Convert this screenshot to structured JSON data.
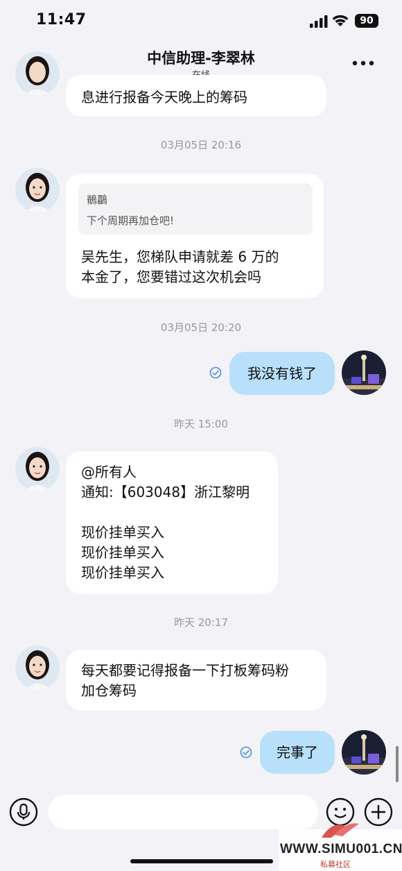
{
  "status_bar": {
    "time": "11:47",
    "battery": "90"
  },
  "header": {
    "title": "中信助理-李翠林",
    "subtitle": "在线"
  },
  "messages": [
    {
      "side": "in",
      "text": "息进行报备今天晚上的筹码"
    },
    {
      "timestamp": "03月05日 20:16"
    },
    {
      "side": "in",
      "quote_name": "鶺鸓",
      "quote_text": "下个周期再加仓吧!",
      "lines": [
        "吴先生，您梯队申请就差 6 万的",
        "本金了，您要错过这次机会吗"
      ]
    },
    {
      "timestamp": "03月05日 20:20"
    },
    {
      "side": "out",
      "text": "我没有钱了"
    },
    {
      "timestamp": "昨天 15:00"
    },
    {
      "side": "in",
      "lines": [
        "@所有人",
        "通知:【603048】浙江黎明",
        "",
        "现价挂单买入",
        "现价挂单买入",
        "现价挂单买入"
      ]
    },
    {
      "timestamp": "昨天 20:17"
    },
    {
      "side": "in",
      "lines": [
        "每天都要记得报备一下打板筹码粉",
        "加仓筹码"
      ]
    },
    {
      "side": "out",
      "text": "完事了"
    }
  ],
  "watermark": {
    "text": "WWW.SIMU001.CN",
    "sub": "私募社区"
  },
  "colors": {
    "background": "#f2f2f7",
    "incoming_bubble": "#ffffff",
    "outgoing_bubble": "#b8e0fb",
    "read_check": "#4a90d9"
  },
  "icons": [
    "back-chevron-icon",
    "more-dots-icon",
    "voice-icon",
    "emoji-icon",
    "add-icon"
  ]
}
